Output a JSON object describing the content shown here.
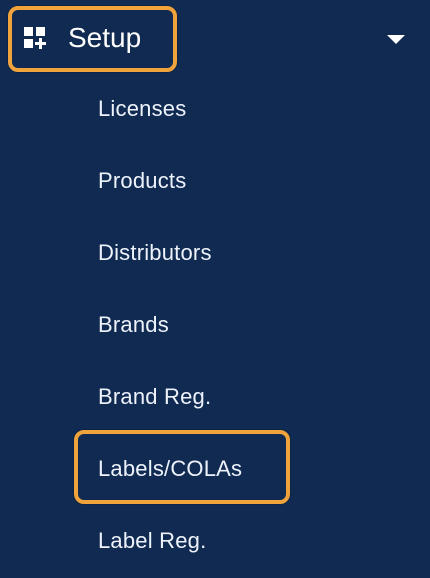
{
  "setup": {
    "label": "Setup",
    "icon": "dashboard-grid-plus-icon",
    "expanded": true
  },
  "menu": {
    "items": [
      {
        "label": "Licenses"
      },
      {
        "label": "Products"
      },
      {
        "label": "Distributors"
      },
      {
        "label": "Brands"
      },
      {
        "label": "Brand Reg."
      },
      {
        "label": "Labels/COLAs",
        "highlighted": true
      },
      {
        "label": "Label Reg."
      }
    ]
  },
  "colors": {
    "background": "#102a52",
    "highlight": "#f1a33b",
    "text": "#eef3fb"
  }
}
